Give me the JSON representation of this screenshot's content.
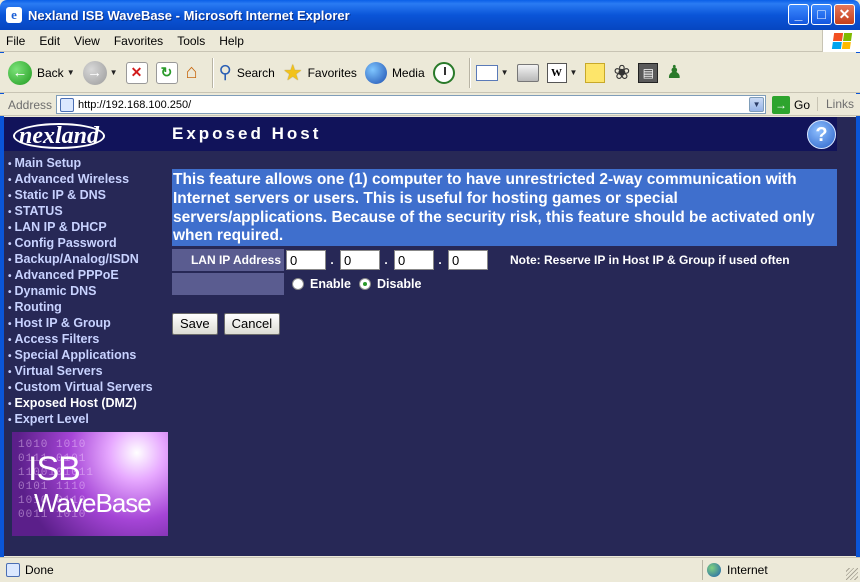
{
  "window": {
    "title": "Nexland ISB WaveBase - Microsoft Internet Explorer",
    "minimize": "_",
    "maximize": "□",
    "close": "✕"
  },
  "menubar": [
    "File",
    "Edit",
    "View",
    "Favorites",
    "Tools",
    "Help"
  ],
  "toolbar": {
    "back": "Back",
    "search": "Search",
    "favorites": "Favorites",
    "media": "Media"
  },
  "address": {
    "label": "Address",
    "url": "http://192.168.100.250/",
    "go": "Go",
    "links": "Links"
  },
  "page": {
    "logo": "nexland",
    "title": "Exposed Host",
    "help": "?"
  },
  "sidebar": {
    "items": [
      {
        "label": "Main Setup",
        "active": false
      },
      {
        "label": "Advanced Wireless",
        "active": false
      },
      {
        "label": "Static IP & DNS",
        "active": false
      },
      {
        "label": "STATUS",
        "active": false
      },
      {
        "label": "LAN IP & DHCP",
        "active": false
      },
      {
        "label": "Config Password",
        "active": false
      },
      {
        "label": "Backup/Analog/ISDN",
        "active": false
      },
      {
        "label": "Advanced PPPoE",
        "active": false
      },
      {
        "label": "Dynamic DNS",
        "active": false
      },
      {
        "label": "Routing",
        "active": false
      },
      {
        "label": "Host IP & Group",
        "active": false
      },
      {
        "label": "Access Filters",
        "active": false
      },
      {
        "label": "Special Applications",
        "active": false
      },
      {
        "label": "Virtual Servers",
        "active": false
      },
      {
        "label": "Custom Virtual Servers",
        "active": false
      },
      {
        "label": "Exposed Host (DMZ)",
        "active": true
      },
      {
        "label": "Expert Level",
        "active": false
      }
    ],
    "promo_line1": "ISB",
    "promo_line2": "WaveBase"
  },
  "main": {
    "description": "This feature allows one (1) computer to have unrestricted 2-way communication with Internet servers or users. This is useful for hosting games or special servers/applications. Because of the security risk, this feature should be activated only when required.",
    "lan_ip_label": "LAN IP Address",
    "ip": [
      "0",
      "0",
      "0",
      "0"
    ],
    "note": "Note: Reserve IP in Host IP & Group if used often",
    "enable_label": "Enable",
    "disable_label": "Disable",
    "selected": "Disable",
    "save": "Save",
    "cancel": "Cancel"
  },
  "status": {
    "text": "Done",
    "zone": "Internet"
  }
}
